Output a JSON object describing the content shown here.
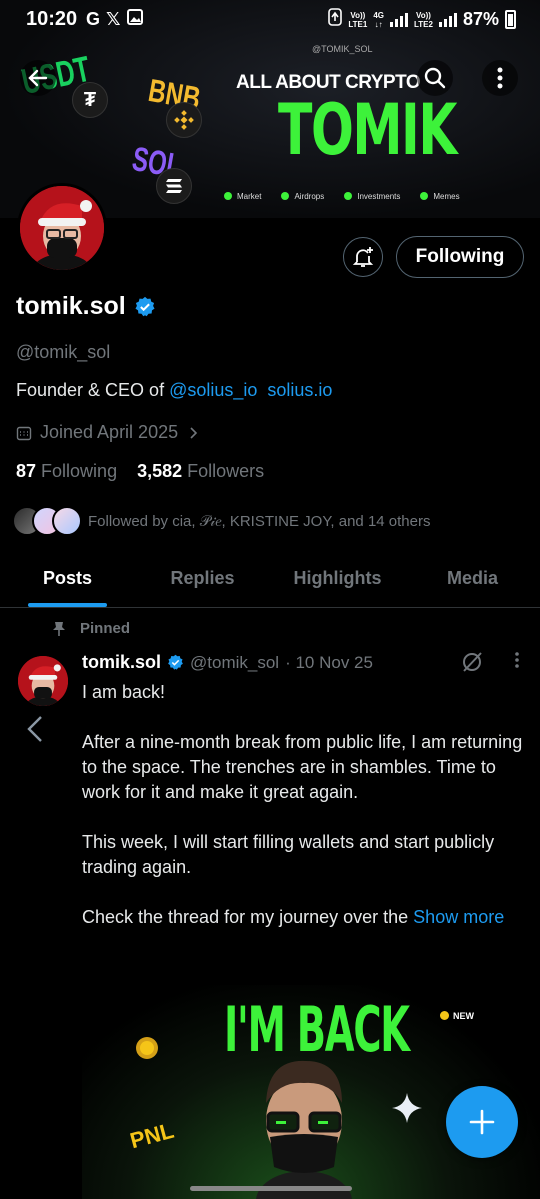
{
  "status_bar": {
    "time": "10:20",
    "left_icons": [
      "google-icon",
      "x-icon",
      "image-icon"
    ],
    "sim1": {
      "top": "Vo))",
      "bottom": "LTE1"
    },
    "net": {
      "top": "4G",
      "bottom": "↓↑"
    },
    "sim2": {
      "top": "Vo))",
      "bottom": "LTE2"
    },
    "battery": "87%"
  },
  "banner": {
    "handle": "@TOMIK_SOL",
    "headline": "ALL ABOUT CRYPTO",
    "brand": "TOMIK",
    "sticker_usdt": "USDT",
    "sticker_bnb": "BNB",
    "sticker_sol": "SOL",
    "tags": [
      "Market",
      "Airdrops",
      "Investments",
      "Memes"
    ]
  },
  "profile": {
    "display_name": "tomik.sol",
    "handle": "@tomik_sol",
    "bio_prefix": "Founder & CEO of ",
    "bio_mention": "@solius_io",
    "bio_link": "solius.io",
    "joined": "Joined April 2025",
    "following_count": "87",
    "following_label": "Following",
    "followers_count": "3,582",
    "followers_label": "Followers",
    "followed_by": "Followed by cia, 𝒫𝒾𝑒, KRISTINE JOY, and 14 others",
    "follow_button": "Following"
  },
  "tabs": [
    "Posts",
    "Replies",
    "Highlights",
    "Media"
  ],
  "post": {
    "pinned_label": "Pinned",
    "author": "tomik.sol",
    "handle": "@tomik_sol",
    "date": "· 10 Nov 25",
    "paragraphs": [
      "I am back!",
      "After a nine-month break from public life, I am returning to the space. The trenches are in shambles. Time to work for it and make it great again.",
      "This week, I will start filling wallets and start publicly trading again."
    ],
    "last_paragraph": "Check the thread for my journey over the ",
    "show_more": "Show more",
    "image_headline": "I'M BACK",
    "image_badge": "NEW",
    "image_pnl": "PNL"
  },
  "colors": {
    "accent": "#1d9bf0",
    "brand_green": "#3df23a",
    "muted": "#71767b"
  }
}
